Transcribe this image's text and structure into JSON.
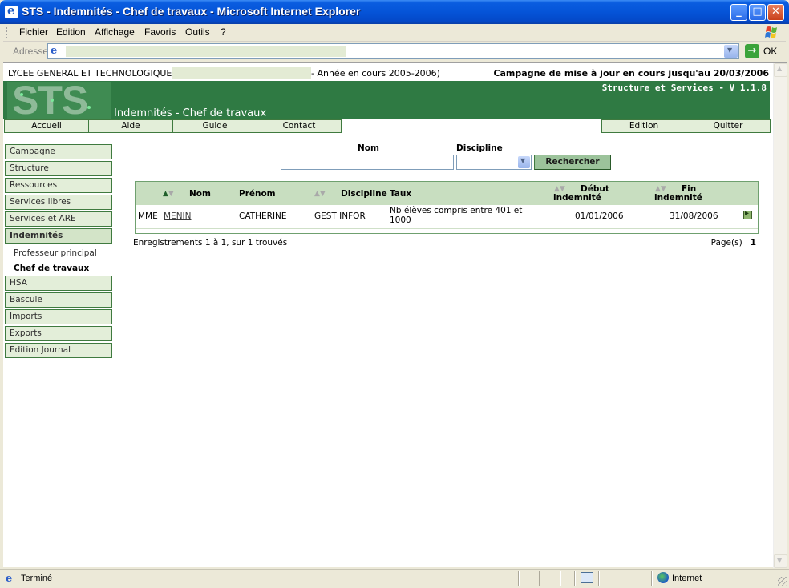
{
  "window": {
    "title": "STS - Indemnités - Chef de travaux - Microsoft Internet Explorer",
    "minimize": "_",
    "maximize": "□",
    "close": "✕"
  },
  "menubar": {
    "items": [
      "Fichier",
      "Edition",
      "Affichage",
      "Favoris",
      "Outils",
      "?"
    ]
  },
  "addressbar": {
    "label": "Adresse",
    "go_label": "OK",
    "go_arrow": "→"
  },
  "page": {
    "school": "LYCEE GENERAL ET TECHNOLOGIQUE",
    "year": "- Année en cours 2005-2006)",
    "campaign": "Campagne de mise à jour en cours jusqu'au 20/03/2006",
    "logo_text": "STS",
    "version": "Structure et Services - V 1.1.8",
    "section_title": "Indemnités - Chef de travaux"
  },
  "topnav": {
    "left": [
      "Accueil",
      "Aide",
      "Guide",
      "Contact"
    ],
    "right": [
      "Edition",
      "Quitter"
    ]
  },
  "sidenav": {
    "items": [
      {
        "label": "Campagne"
      },
      {
        "label": "Structure"
      },
      {
        "label": "Ressources"
      },
      {
        "label": "Services libres"
      },
      {
        "label": "Services et ARE"
      },
      {
        "label": "Indemnités",
        "active": true
      },
      {
        "label": "HSA"
      },
      {
        "label": "Bascule"
      },
      {
        "label": "Imports"
      },
      {
        "label": "Exports"
      },
      {
        "label": "Edition Journal"
      }
    ],
    "subitems": [
      {
        "label": "Professeur principal"
      },
      {
        "label": "Chef de travaux",
        "active": true
      }
    ]
  },
  "search": {
    "nom_label": "Nom",
    "discipline_label": "Discipline",
    "nom_value": "",
    "discipline_value": "",
    "button": "Rechercher"
  },
  "table": {
    "headers": {
      "nom": "Nom",
      "prenom": "Prénom",
      "discipline": "Discipline",
      "taux": "Taux",
      "debut_line1": "Début",
      "debut_line2": "indemnité",
      "fin_line1": "Fin",
      "fin_line2": "indemnité"
    },
    "rows": [
      {
        "civilite": "MME",
        "nom": "MENIN",
        "prenom": "CATHERINE",
        "discipline": "GEST INFOR",
        "taux_line1": "Nb élèves compris entre 401 et",
        "taux_line2": "1000",
        "debut": "01/01/2006",
        "fin": "31/08/2006"
      }
    ]
  },
  "pagination": {
    "count": "Enregistrements 1 à 1, sur 1 trouvés",
    "pages_label": "Page(s)",
    "current_page": "1"
  },
  "statusbar": {
    "text": "Terminé",
    "zone": "Internet"
  }
}
